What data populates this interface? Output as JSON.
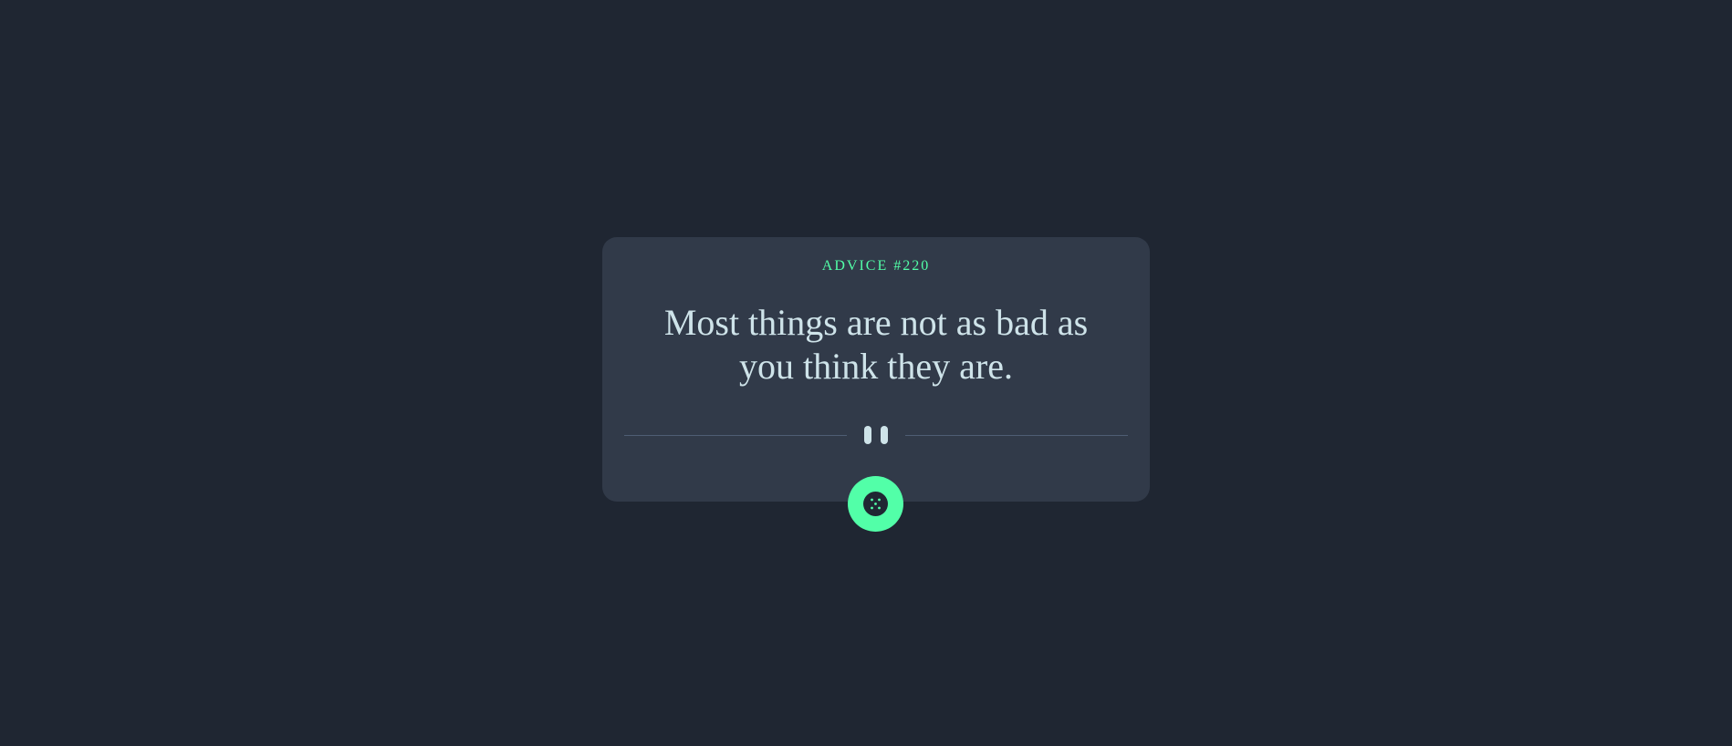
{
  "advice": {
    "id_label": "ADVICE #220",
    "text": "Most things are not as bad as you think they are."
  },
  "icons": {
    "divider": "pause-icon",
    "button": "dice-icon"
  },
  "colors": {
    "background": "#1f2632",
    "card": "#313a49",
    "accent": "#52ffa8",
    "text": "#cee3e9",
    "divider": "#4f5d74"
  }
}
